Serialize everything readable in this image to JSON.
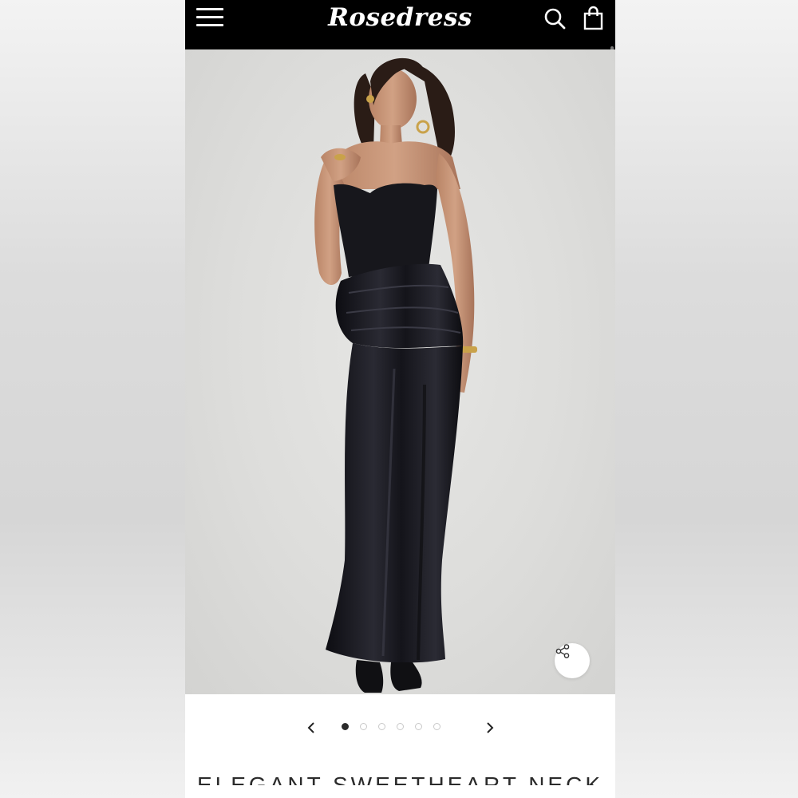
{
  "header": {
    "logo_text": "Rosedress",
    "icons": [
      "menu-icon",
      "search-icon",
      "shopping-bag-icon"
    ]
  },
  "gallery": {
    "slide_count": 6,
    "active_slide": 1,
    "share_icon": "share-icon",
    "prev_icon": "chevron-left-icon",
    "next_icon": "chevron-right-icon"
  },
  "product": {
    "title": "ELEGANT SWEETHEART NECK"
  },
  "colors": {
    "header_bg": "#000000",
    "active_dot": "#2b2b2b",
    "dress": "#141418"
  }
}
